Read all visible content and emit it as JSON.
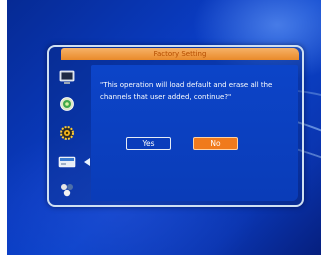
{
  "dialog": {
    "title": "Factory Setting",
    "message": "\"This operation will load default and erase all the channels that user added, continue?\"",
    "buttons": {
      "yes": "Yes",
      "no": "No"
    }
  },
  "sidebar": {
    "items": [
      {
        "icon": "tv-monitor-icon"
      },
      {
        "icon": "satellite-dish-icon"
      },
      {
        "icon": "settings-gear-icon"
      },
      {
        "icon": "receiver-box-icon",
        "selected": true
      },
      {
        "icon": "games-icon"
      }
    ]
  },
  "colors": {
    "title_bar": "#e98a2a",
    "focused_button": "#f07a1c",
    "background": "#0a3cc2"
  }
}
